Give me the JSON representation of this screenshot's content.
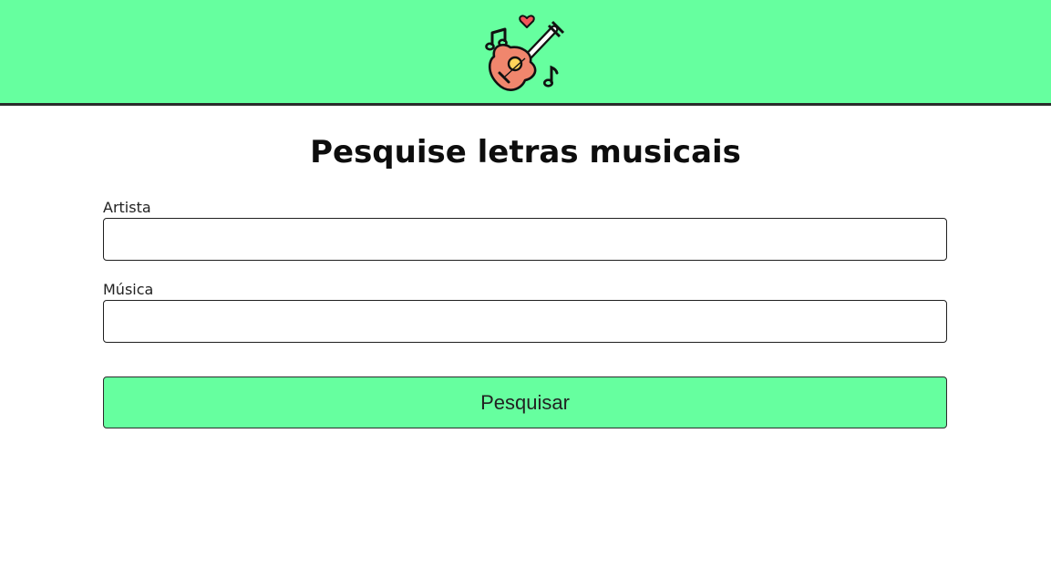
{
  "header": {
    "logo_icon": "guitar-music-notes-heart-icon",
    "background_color": "#66ff9f"
  },
  "main": {
    "title": "Pesquise letras musicais",
    "artist": {
      "label": "Artista",
      "value": "",
      "placeholder": ""
    },
    "song": {
      "label": "Música",
      "value": "",
      "placeholder": ""
    },
    "search_button_label": "Pesquisar",
    "button_color": "#66ff9f"
  }
}
